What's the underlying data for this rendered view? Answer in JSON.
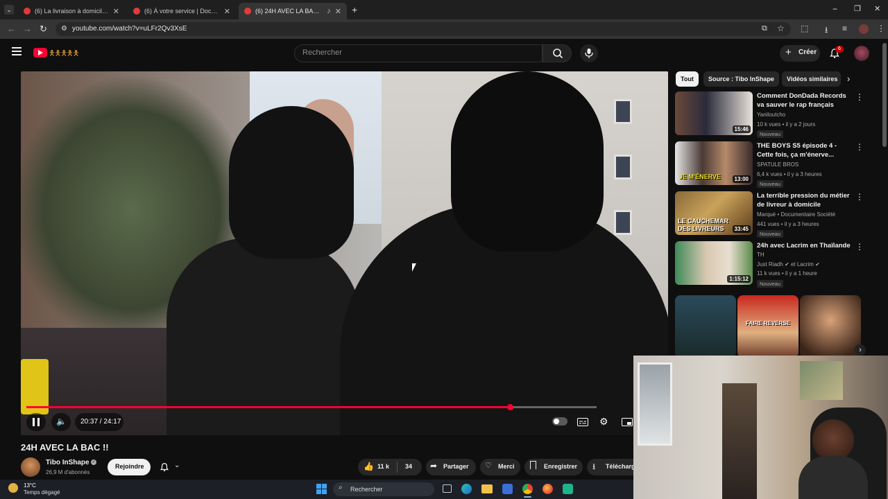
{
  "browser": {
    "tabs": [
      {
        "label": "(6) La livraison à domicile : de l'"
      },
      {
        "label": "(6) À votre service | Documenta"
      },
      {
        "label": "(6) 24H AVEC LA BAC !! - Yo"
      }
    ],
    "url": "youtube.com/watch?v=uLFr2Qv3XsE"
  },
  "header": {
    "search_placeholder": "Rechercher",
    "create_label": "Créer",
    "notification_count": "6"
  },
  "player": {
    "time_label": "20:37 / 24:17",
    "progress_fraction": 0.8476
  },
  "video": {
    "title": "24H AVEC LA BAC !!",
    "channel_name": "Tibo InShape",
    "subscribers": "26,9 M d'abonnés",
    "join_label": "Rejoindre",
    "likes": "11 k",
    "comments": "34",
    "share_label": "Partager",
    "thanks_label": "Merci",
    "save_label": "Enregistrer",
    "download_label": "Télécharg"
  },
  "sidebar": {
    "chips": [
      "Tout",
      "Source : Tibo InShape",
      "Vidéos similaires"
    ],
    "recommendations": [
      {
        "title": "Comment DonDada Records va sauver le rap français",
        "channel": "Yaniloutcho",
        "meta": "10 k vues • il y a 2 jours",
        "badge": "Nouveau",
        "duration": "15:46"
      },
      {
        "title": "THE BOYS S5 épisode 4 - Cette fois, ça m'énerve...",
        "channel": "SPATULE BROS",
        "meta": "6,4 k vues • il y a 3 heures",
        "badge": "Nouveau",
        "duration": "13:00",
        "thumb_text": "JE M'ÉNERVE"
      },
      {
        "title": "La terrible pression du métier de livreur à domicile",
        "channel": "Marqué • Documentaire Société",
        "meta": "441 vues • il y a 3 heures",
        "badge": "Nouveau",
        "duration": "33:45",
        "thumb_text": "LE CAUCHEMAR DES LIVREURS"
      },
      {
        "title": "24h avec Lacrim en Thaïlande",
        "subtitle": "TH",
        "channel": "Just Riadh ✔ et Lacrim ✔",
        "meta": "11 k vues • il y a 1 heure",
        "badge": "Nouveau",
        "duration": "1:15:12"
      }
    ],
    "shelf_text": "FAIRE REVERSE"
  },
  "taskbar": {
    "temp": "13°C",
    "weather": "Temps dégagé",
    "search_label": "Rechercher"
  },
  "colors": {
    "accent": "#ff0033",
    "background": "#0f0f0f",
    "chip_bg": "#272727"
  }
}
